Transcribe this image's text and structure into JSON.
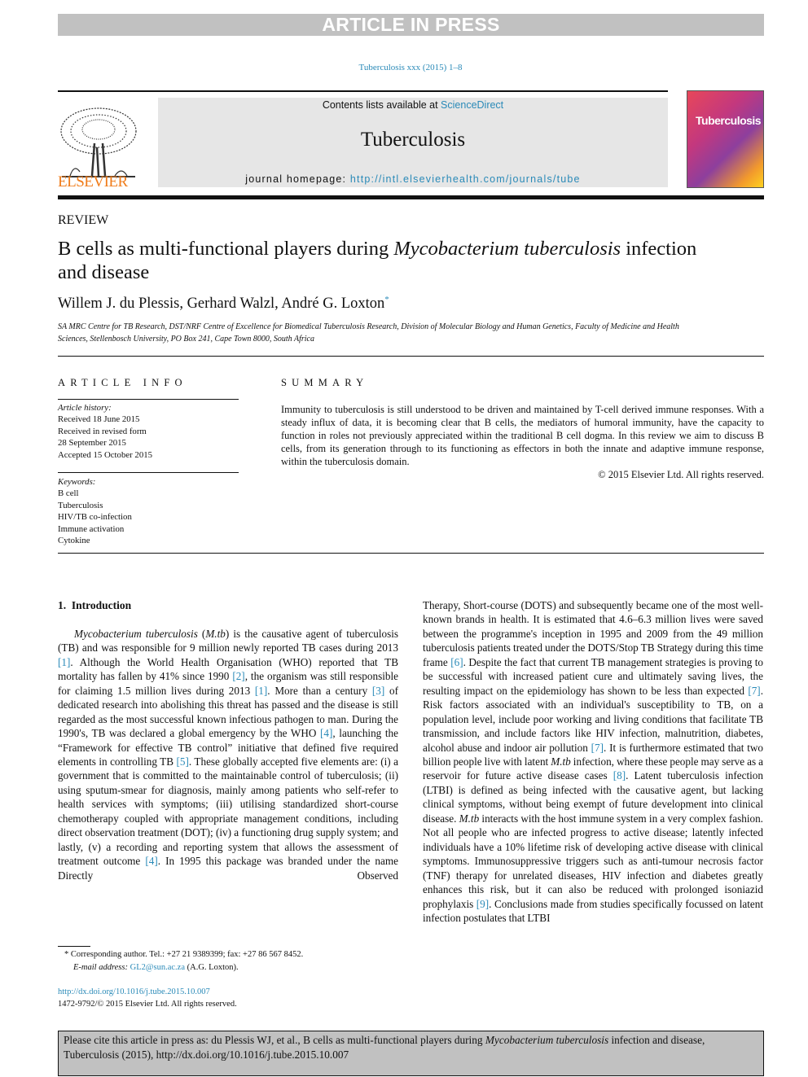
{
  "banner_top": "ARTICLE IN PRESS",
  "journal_ref": "Tuberculosis xxx (2015) 1–8",
  "header": {
    "contents_prefix": "Contents lists available at ",
    "contents_link": "ScienceDirect",
    "journal": "Tuberculosis",
    "homepage_prefix": "journal homepage: ",
    "homepage_url": "http://intl.elsevierhealth.com/journals/tube",
    "publisher": "ELSEVIER",
    "cover_title": "Tuberculosis"
  },
  "article": {
    "type": "REVIEW",
    "title_pre": "B cells as multi-functional players during ",
    "title_italic": "Mycobacterium tuberculosis",
    "title_post": " infection and disease",
    "authors": "Willem J. du Plessis, Gerhard Walzl, André G. Loxton",
    "author_mark": "*",
    "affiliation": "SA MRC Centre for TB Research, DST/NRF Centre of Excellence for Biomedical Tuberculosis Research, Division of Molecular Biology and Human Genetics, Faculty of Medicine and Health Sciences, Stellenbosch University, PO Box 241, Cape Town 8000, South Africa"
  },
  "article_info": {
    "heading": "ARTICLE INFO",
    "history_label": "Article history:",
    "history": [
      "Received 18 June 2015",
      "Received in revised form",
      "28 September 2015",
      "Accepted 15 October 2015"
    ],
    "keywords_label": "Keywords:",
    "keywords": [
      "B cell",
      "Tuberculosis",
      "HIV/TB co-infection",
      "Immune activation",
      "Cytokine"
    ]
  },
  "summary": {
    "heading": "SUMMARY",
    "text": "Immunity to tuberculosis is still understood to be driven and maintained by T-cell derived immune responses. With a steady influx of data, it is becoming clear that B cells, the mediators of humoral immunity, have the capacity to function in roles not previously appreciated within the traditional B cell dogma. In this review we aim to discuss B cells, from its generation through to its functioning as effectors in both the innate and adaptive immune response, within the tuberculosis domain.",
    "copyright": "© 2015 Elsevier Ltd. All rights reserved."
  },
  "intro": {
    "heading": "1. Introduction",
    "col1": [
      {
        "i": "Mycobacterium tuberculosis"
      },
      {
        "t": " ("
      },
      {
        "i": "M.tb"
      },
      {
        "t": ") is the causative agent of tuberculosis (TB) and was responsible for 9 million newly reported TB cases during 2013 "
      },
      {
        "r": "[1]"
      },
      {
        "t": ". Although the World Health Organisation (WHO) reported that TB mortality has fallen by 41% since 1990 "
      },
      {
        "r": "[2]"
      },
      {
        "t": ", the organism was still responsible for claiming 1.5 million lives during 2013 "
      },
      {
        "r": "[1]"
      },
      {
        "t": ". More than a century "
      },
      {
        "r": "[3]"
      },
      {
        "t": " of dedicated research into abolishing this threat has passed and the disease is still regarded as the most successful known infectious pathogen to man. During the 1990's, TB was declared a global emergency by the WHO "
      },
      {
        "r": "[4]"
      },
      {
        "t": ", launching the “Framework for effective TB control” initiative that defined five required elements in controlling TB "
      },
      {
        "r": "[5]"
      },
      {
        "t": ". These globally accepted five elements are: (i) a government that is committed to the maintainable control of tuberculosis; (ii) using sputum-smear for diagnosis, mainly among patients who self-refer to health services with symptoms; (iii) utilising standardized short-course chemotherapy coupled with appropriate management conditions, including direct observation treatment (DOT); (iv) a functioning drug supply system; and lastly, (v) a recording and reporting system that allows the assessment of treatment outcome "
      },
      {
        "r": "[4]"
      },
      {
        "t": ". In 1995 this package was branded under the name Directly Observed"
      }
    ],
    "col2": [
      {
        "t": "Therapy, Short-course (DOTS) and subsequently became one of the most well-known brands in health. It is estimated that 4.6–6.3 million lives were saved between the programme's inception in 1995 and 2009 from the 49 million tuberculosis patients treated under the DOTS/Stop TB Strategy during this time frame "
      },
      {
        "r": "[6]"
      },
      {
        "t": ". Despite the fact that current TB management strategies is proving to be successful with increased patient cure and ultimately saving lives, the resulting impact on the epidemiology has shown to be less than expected "
      },
      {
        "r": "[7]"
      },
      {
        "t": ". Risk factors associated with an individual's susceptibility to TB, on a population level, include poor working and living conditions that facilitate TB transmission, and include factors like HIV infection, malnutrition, diabetes, alcohol abuse and indoor air pollution "
      },
      {
        "r": "[7]"
      },
      {
        "t": ". It is furthermore estimated that two billion people live with latent "
      },
      {
        "i": "M.tb"
      },
      {
        "t": " infection, where these people may serve as a reservoir for future active disease cases "
      },
      {
        "r": "[8]"
      },
      {
        "t": ". Latent tuberculosis infection (LTBI) is defined as being infected with the causative agent, but lacking clinical symptoms, without being exempt of future development into clinical disease. "
      },
      {
        "i": "M.tb"
      },
      {
        "t": " interacts with the host immune system in a very complex fashion. Not all people who are infected progress to active disease; latently infected individuals have a 10% lifetime risk of developing active disease with clinical symptoms. Immunosuppressive triggers such as anti-tumour necrosis factor (TNF) therapy for unrelated diseases, HIV infection and diabetes greatly enhances this risk, but it can also be reduced with prolonged isoniazid prophylaxis "
      },
      {
        "r": "[9]"
      },
      {
        "t": ". Conclusions made from studies specifically focussed on latent infection postulates that LTBI"
      }
    ]
  },
  "footnote": {
    "mark": "*",
    "text": " Corresponding author. Tel.: +27 21 9389399; fax: +27 86 567 8452.",
    "email_label": "E-mail address: ",
    "email": "GL2@sun.ac.za",
    "email_suffix": " (A.G. Loxton)."
  },
  "doi": "http://dx.doi.org/10.1016/j.tube.2015.10.007",
  "issn": "1472-9792/© 2015 Elsevier Ltd. All rights reserved.",
  "cite": {
    "pre": "Please cite this article in press as: du Plessis WJ, et al., B cells as multi-functional players during ",
    "italic": "Mycobacterium tuberculosis",
    "post": " infection and disease, Tuberculosis (2015), http://dx.doi.org/10.1016/j.tube.2015.10.007"
  },
  "colors": {
    "link": "#2a8ab8",
    "elsevier": "#f07c1a",
    "banner": "#c1c1c1"
  }
}
